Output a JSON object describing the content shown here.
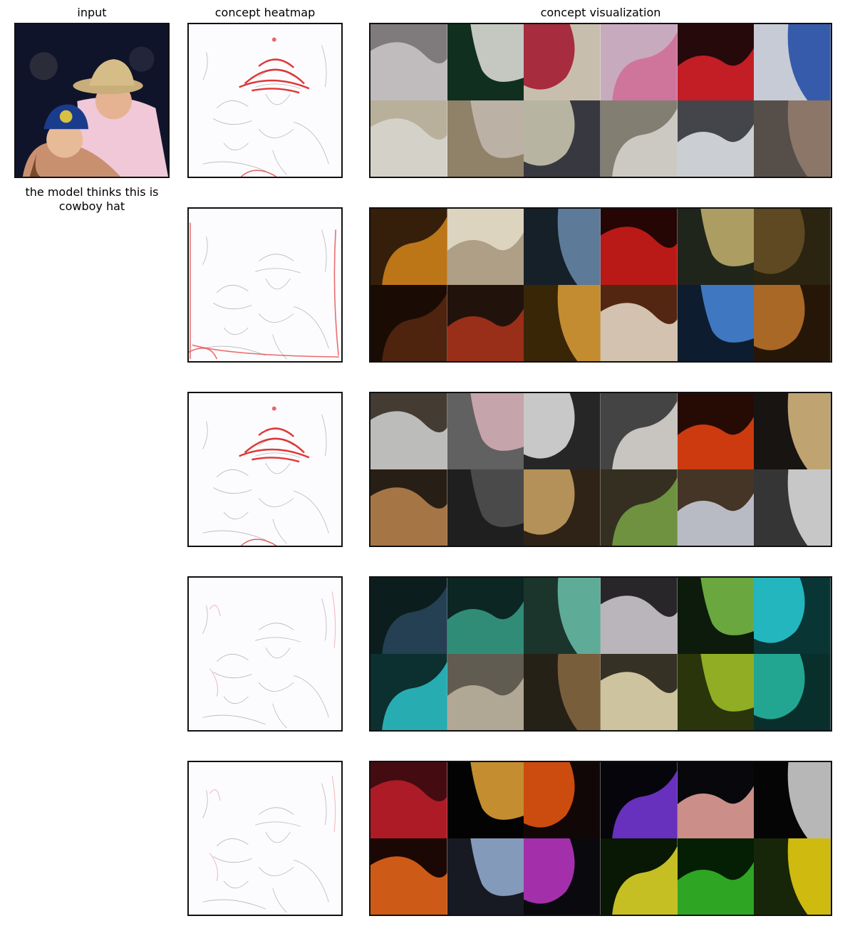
{
  "headers": {
    "input": "input",
    "heatmap": "concept heatmap",
    "visualization": "concept visualization"
  },
  "caption": "the model thinks this is cowboy hat",
  "rows": [
    {
      "heatmap_focus": "hat",
      "tiles": [
        [
          "#8a8586",
          "#d7d3d6"
        ],
        [
          "#123322",
          "#e6e8e2"
        ],
        [
          "#d9cfbd",
          "#b2233a"
        ],
        [
          "#dab9cf",
          "#e27aa6"
        ],
        [
          "#2a0a0c",
          "#e3232c"
        ],
        [
          "#d8dde9",
          "#2f58b5"
        ],
        [
          "#c8bfa8",
          "#e8e6dd"
        ],
        [
          "#9d8c72",
          "#cfc6b8"
        ],
        [
          "#3c3d46",
          "#d4d0b8"
        ],
        [
          "#8e8a7c",
          "#e5e2da"
        ],
        [
          "#4a4a52",
          "#e9eef2"
        ],
        [
          "#5e5650",
          "#9c8474"
        ]
      ]
    },
    {
      "heatmap_focus": "edges",
      "tiles": [
        [
          "#3a220c",
          "#d98a1c"
        ],
        [
          "#efe6d0",
          "#b8a88c"
        ],
        [
          "#18232d",
          "#6d8fb2"
        ],
        [
          "#2a0606",
          "#d8201c"
        ],
        [
          "#23291e",
          "#c9b672"
        ],
        [
          "#2f2812",
          "#6c5428"
        ],
        [
          "#1d0e06",
          "#5a2a12"
        ],
        [
          "#24150e",
          "#b2361c"
        ],
        [
          "#3d2a08",
          "#e2a23a"
        ],
        [
          "#5a2a12",
          "#f2e2ce"
        ],
        [
          "#0f2034",
          "#4a8ce0"
        ],
        [
          "#2a1808",
          "#c47a2e"
        ]
      ]
    },
    {
      "heatmap_focus": "hat",
      "tiles": [
        [
          "#4a4038",
          "#d8d8d8"
        ],
        [
          "#6a6a6a",
          "#e1b8c1"
        ],
        [
          "#2a2a2a",
          "#e9e9e9"
        ],
        [
          "#4a4a4a",
          "#e6e2dc"
        ],
        [
          "#2a0c06",
          "#f04412"
        ],
        [
          "#1a1614",
          "#e0c085"
        ],
        [
          "#2b2218",
          "#c08852"
        ],
        [
          "#222222",
          "#565656"
        ],
        [
          "#33261a",
          "#d0a866"
        ],
        [
          "#3a3424",
          "#7ea84a"
        ],
        [
          "#4a3a2a",
          "#d2d8e4"
        ],
        [
          "#3a3a3a",
          "#e6e6e6"
        ]
      ]
    },
    {
      "heatmap_focus": "faint",
      "tiles": [
        [
          "#0e2020",
          "#2a4a5e"
        ],
        [
          "#0e2a26",
          "#3aa28a"
        ],
        [
          "#1e3a30",
          "#6ec6b0"
        ],
        [
          "#2c2a2c",
          "#d8d2d8"
        ],
        [
          "#0e1e0e",
          "#7cc44a"
        ],
        [
          "#0a3a3a",
          "#2ad2dc"
        ],
        [
          "#0e3434",
          "#2ec8cc"
        ],
        [
          "#6a6458",
          "#c9bda8"
        ],
        [
          "#2a2418",
          "#8c6c46"
        ],
        [
          "#3a3628",
          "#efe2b8"
        ],
        [
          "#2e3a0e",
          "#a8c82a"
        ],
        [
          "#0a3430",
          "#2ac0a8"
        ]
      ]
    },
    {
      "heatmap_focus": "faint",
      "tiles": [
        [
          "#4a0e12",
          "#c4202c"
        ],
        [
          "#040404",
          "#e6a63a"
        ],
        [
          "#140808",
          "#f05a12"
        ],
        [
          "#06060c",
          "#7a3ae0"
        ],
        [
          "#08080e",
          "#f0a8a0"
        ],
        [
          "#060606",
          "#d8d8d8"
        ],
        [
          "#1e0804",
          "#f06a1a"
        ],
        [
          "#1a1c26",
          "#9ab4d8"
        ],
        [
          "#0a0a10",
          "#c03ac8"
        ],
        [
          "#0a1a06",
          "#e8e02a"
        ],
        [
          "#062206",
          "#36c02a"
        ],
        [
          "#1a2a0a",
          "#f2d812"
        ]
      ]
    }
  ]
}
